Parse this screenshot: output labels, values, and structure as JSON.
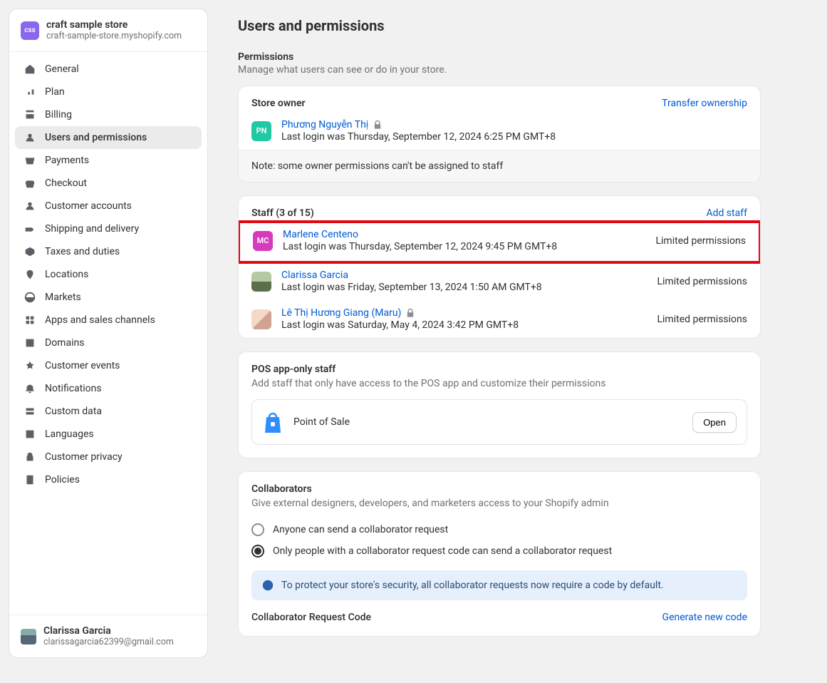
{
  "store": {
    "badge": "css",
    "name": "craft sample store",
    "domain": "craft-sample-store.myshopify.com"
  },
  "sidebarUser": {
    "name": "Clarissa Garcia",
    "email": "clarissagarcia62399@gmail.com"
  },
  "nav": [
    "General",
    "Plan",
    "Billing",
    "Users and permissions",
    "Payments",
    "Checkout",
    "Customer accounts",
    "Shipping and delivery",
    "Taxes and duties",
    "Locations",
    "Markets",
    "Apps and sales channels",
    "Domains",
    "Customer events",
    "Notifications",
    "Custom data",
    "Languages",
    "Customer privacy",
    "Policies"
  ],
  "navActiveIndex": 3,
  "pageTitle": "Users and permissions",
  "permissions": {
    "heading": "Permissions",
    "sub": "Manage what users can see or do in your store."
  },
  "owner": {
    "cardTitle": "Store owner",
    "transferLink": "Transfer ownership",
    "initials": "PN",
    "name": "Phương Nguyễn Thị",
    "lastLogin": "Last login was Thursday, September 12, 2024 6:25 PM GMT+8",
    "note": "Note: some owner permissions can't be assigned to staff"
  },
  "staff": {
    "title": "Staff (3 of 15)",
    "addLink": "Add staff",
    "limitedLabel": "Limited permissions",
    "list": [
      {
        "initials": "MC",
        "name": "Marlene Centeno",
        "lastLogin": "Last login was Thursday, September 12, 2024 9:45 PM GMT+8",
        "highlight": true
      },
      {
        "name": "Clarissa Garcia",
        "lastLogin": "Last login was Friday, September 13, 2024 1:50 AM GMT+8"
      },
      {
        "name": "Lê Thị Hương Giang (Maru)",
        "lastLogin": "Last login was Saturday, May 4, 2024 3:42 PM GMT+8",
        "lock": true
      }
    ]
  },
  "pos": {
    "title": "POS app-only staff",
    "sub": "Add staff that only have access to the POS app and customize their permissions",
    "label": "Point of Sale",
    "openBtn": "Open"
  },
  "collab": {
    "title": "Collaborators",
    "sub": "Give external designers, developers, and marketers access to your Shopify admin",
    "opt1": "Anyone can send a collaborator request",
    "opt2": "Only people with a collaborator request code can send a collaborator request",
    "banner": "To protect your store's security, all collaborator requests now require a code by default.",
    "codeLabel": "Collaborator Request Code",
    "generateLink": "Generate new code"
  }
}
